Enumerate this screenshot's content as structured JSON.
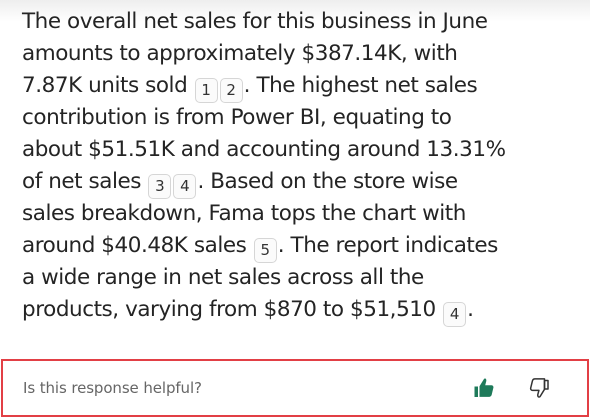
{
  "response": {
    "lines": [
      [
        {
          "t": "The overall net sales for this business in June"
        }
      ],
      [
        {
          "t": "amounts to approximately $387.14K, with"
        }
      ],
      [
        {
          "t": "7.87K units sold "
        },
        {
          "ref": "1"
        },
        {
          "ref": "2"
        },
        {
          "t": ". The highest net sales"
        }
      ],
      [
        {
          "t": "contribution is from Power BI, equating to"
        }
      ],
      [
        {
          "t": "about $51.51K and accounting around 13.31%"
        }
      ],
      [
        {
          "t": "of net sales "
        },
        {
          "ref": "3"
        },
        {
          "ref": "4"
        },
        {
          "t": ". Based on the store wise"
        }
      ],
      [
        {
          "t": "sales breakdown, Fama tops the chart with"
        }
      ],
      [
        {
          "t": "around $40.48K sales "
        },
        {
          "ref": "5"
        },
        {
          "t": ". The report indicates"
        }
      ],
      [
        {
          "t": "a wide range in net sales across all the"
        }
      ],
      [
        {
          "t": "products, varying from $870 to $51,510 "
        },
        {
          "ref": "4"
        },
        {
          "t": "."
        }
      ]
    ]
  },
  "feedback": {
    "prompt": "Is this response helpful?",
    "thumbs_up_icon": "thumbs-up-filled-icon",
    "thumbs_down_icon": "thumbs-down-outline-icon",
    "accent_color": "#1e7a5a",
    "border_color": "#e23f45"
  }
}
